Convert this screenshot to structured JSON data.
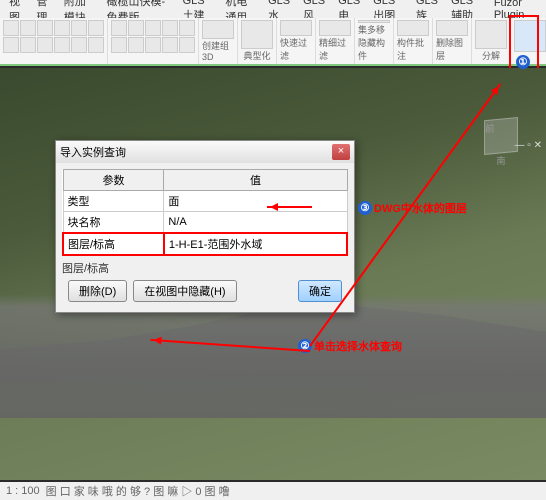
{
  "menubar": {
    "items": [
      "视图",
      "管理",
      "附加模块",
      "橄榄山快模-免费版",
      "GLS土建",
      "机电通用",
      "GLS水",
      "GLS风",
      "GLS电",
      "GLS出图",
      "GLS族",
      "GLS辅助",
      "Fuzor Plugin"
    ]
  },
  "ribbon": {
    "groups": [
      {
        "label": ""
      },
      {
        "label": "创建组3D"
      },
      {
        "label": "典型化"
      },
      {
        "label": "快速过滤"
      },
      {
        "label": "精细过滤"
      },
      {
        "label": "集多移\n隐藏构件"
      },
      {
        "label": "构件批注"
      },
      {
        "label": "删除图层"
      },
      {
        "label": "分解"
      }
    ]
  },
  "dialog": {
    "title": "导入实例查询",
    "headers": {
      "param": "参数",
      "value": "值"
    },
    "rows": [
      {
        "param": "类型",
        "value": "面"
      },
      {
        "param": "块名称",
        "value": "N/A"
      },
      {
        "param": "图层/标高",
        "value": "1-H-E1-范围外水域"
      }
    ],
    "section_label": "图层/标高",
    "buttons": {
      "delete": "删除(D)",
      "hide": "在视图中隐藏(H)",
      "ok": "确定"
    },
    "close": "×"
  },
  "annotations": {
    "a1": {
      "num": "①"
    },
    "a2": {
      "num": "②",
      "text": "单击选择水体查询"
    },
    "a3": {
      "num": "③",
      "text": "DWG中水体的图层"
    }
  },
  "viewcube": {
    "face": "前",
    "direction": "南"
  },
  "statusbar": {
    "scale": "1 : 100",
    "tools": "图 口 家 味 哦 的 够 ? 图 嘛 ▷ 0 图 噜"
  },
  "window_controls": "— ▫ ✕"
}
